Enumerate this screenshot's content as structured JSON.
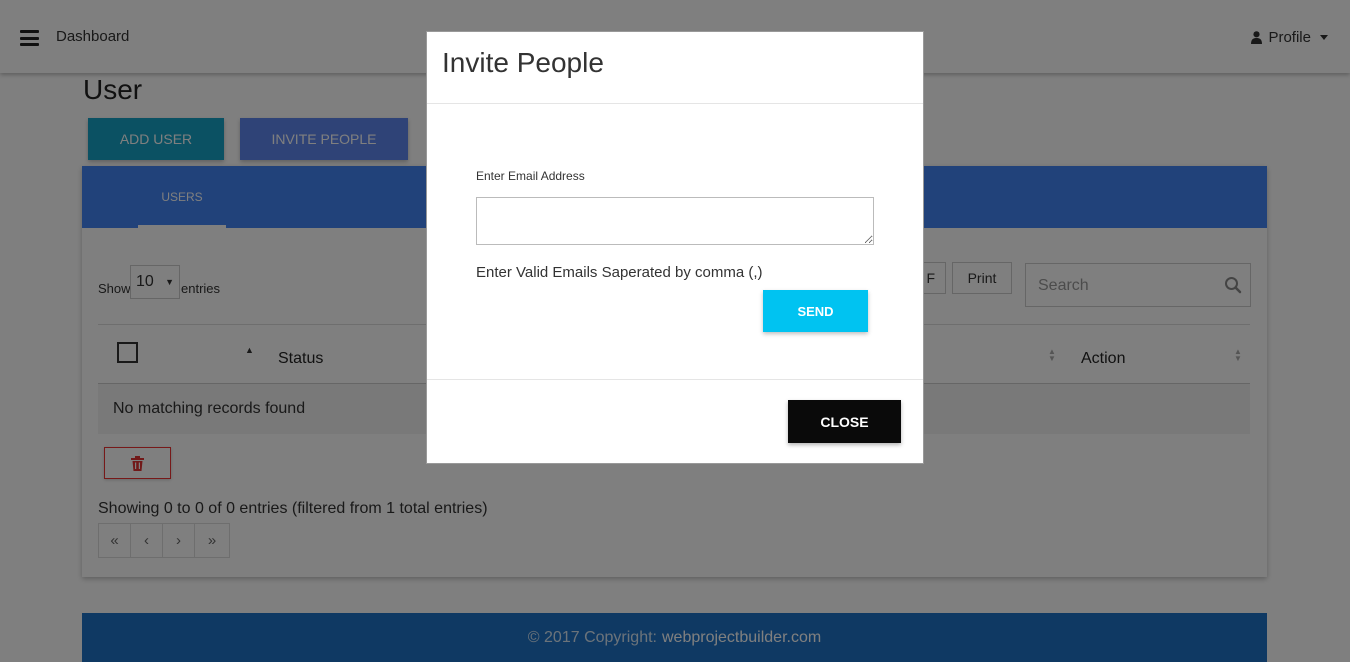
{
  "navbar": {
    "title": "Dashboard",
    "profile_label": "Profile"
  },
  "page": {
    "title": "User",
    "add_user_label": "ADD USER",
    "invite_people_label": "INVITE PEOPLE"
  },
  "tabs": [
    {
      "label": "USERS",
      "active": true
    }
  ],
  "table_controls": {
    "show_label": "Show",
    "length_value": "10",
    "entries_label": "entries",
    "pdf_label_fragment": "F",
    "print_label": "Print",
    "search_placeholder": "Search"
  },
  "table": {
    "columns": [
      "Status",
      "Action"
    ],
    "empty_message": "No matching records found"
  },
  "info_text": "Showing 0 to 0 of 0 entries (filtered from 1 total entries)",
  "pagination": [
    "«",
    "‹",
    "›",
    "»"
  ],
  "footer": {
    "copyright": "© 2017 Copyright:",
    "site": "webprojectbuilder.com"
  },
  "modal": {
    "title": "Invite People",
    "email_label": "Enter Email Address",
    "email_value": "",
    "hint": "Enter Valid Emails Saperated by comma (,)",
    "send_label": "SEND",
    "close_label": "CLOSE"
  },
  "colors": {
    "primary_blue": "#4285f4",
    "add_user_teal": "#17a2c6",
    "invite_blue": "#5f87ee",
    "send_cyan": "#00c3f1",
    "footer_blue": "#1e73c7",
    "delete_red": "#e33333"
  },
  "icons": {
    "menu": "hamburger-icon",
    "profile": "user-icon",
    "search": "search-icon",
    "delete": "trash-icon"
  }
}
